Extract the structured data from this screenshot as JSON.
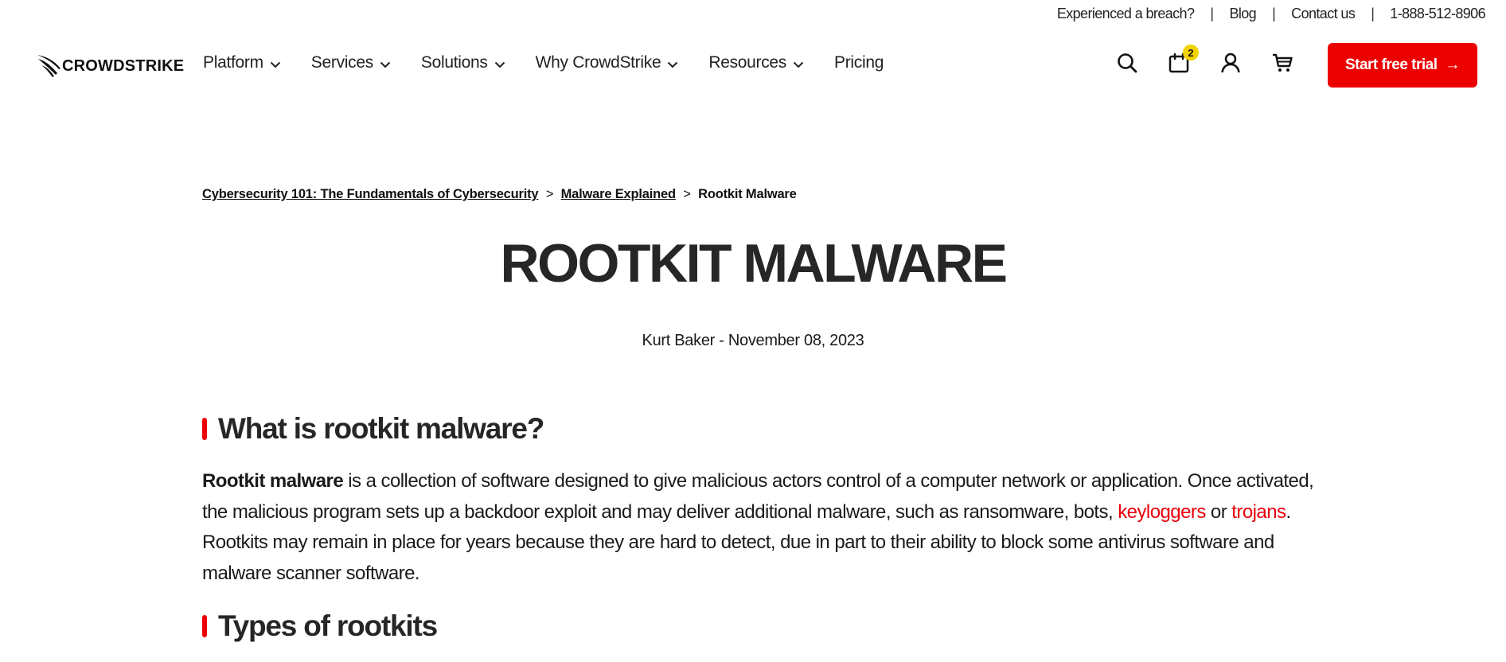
{
  "utility": {
    "breach": "Experienced a breach?",
    "blog": "Blog",
    "contact": "Contact us",
    "phone": "1-888-512-8906",
    "separator": "|"
  },
  "logo": {
    "text": "CROWDSTRIKE"
  },
  "nav": {
    "items": [
      {
        "label": "Platform",
        "has_dropdown": true
      },
      {
        "label": "Services",
        "has_dropdown": true
      },
      {
        "label": "Solutions",
        "has_dropdown": true
      },
      {
        "label": "Why CrowdStrike",
        "has_dropdown": true
      },
      {
        "label": "Resources",
        "has_dropdown": true
      },
      {
        "label": "Pricing",
        "has_dropdown": false
      }
    ]
  },
  "header_icons": {
    "search": "search-icon",
    "calendar": "calendar-icon",
    "calendar_badge": "2",
    "account": "user-icon",
    "cart": "cart-icon"
  },
  "cta": {
    "label": "Start free trial",
    "arrow": "→",
    "color": "#ec0000"
  },
  "breadcrumb": {
    "items": [
      "Cybersecurity 101: The Fundamentals of Cybersecurity",
      "Malware Explained",
      "Rootkit Malware"
    ],
    "separator": ">"
  },
  "article": {
    "title": "ROOTKIT MALWARE",
    "byline": "Kurt Baker - November 08, 2023",
    "section1": {
      "heading": "What is rootkit malware?",
      "bold_lead": "Rootkit malware",
      "text_a": " is a collection of software designed to give malicious actors control of a computer network or application. Once activated, the malicious program sets up a backdoor exploit and may deliver additional malware, such as ransomware, bots, ",
      "link1": "keyloggers",
      "text_b": " or ",
      "link2": "trojans",
      "text_c": ". Rootkits may remain in place for years because they are hard to detect, due in part to their ability to block some antivirus software and malware scanner software."
    },
    "section2": {
      "heading": "Types of rootkits"
    }
  },
  "colors": {
    "accent": "#ec0000",
    "link": "#e8000b",
    "badge": "#f2d202",
    "text": "#1a1a1a"
  }
}
